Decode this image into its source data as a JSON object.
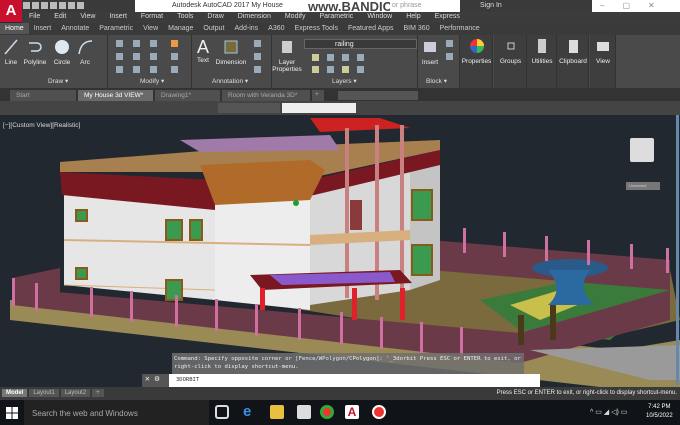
{
  "titlebar": {
    "app_logo": "A",
    "title": "Autodesk AutoCAD 2017   My House",
    "watermark": "www.BANDICAM.com",
    "search_placeholder": "or phrase",
    "sign_in": "Sign In"
  },
  "menu": [
    "File",
    "Edit",
    "View",
    "Insert",
    "Format",
    "Tools",
    "Draw",
    "Dimension",
    "Modify",
    "Parametric",
    "Window",
    "Help",
    "Express"
  ],
  "ribbon_tabs": [
    "Home",
    "Insert",
    "Annotate",
    "Parametric",
    "View",
    "Manage",
    "Output",
    "Add-ins",
    "A360",
    "Express Tools",
    "Featured Apps",
    "BIM 360",
    "Performance"
  ],
  "ribbon": {
    "draw": {
      "label": "Draw ▾",
      "tools": [
        "Line",
        "Polyline",
        "Circle",
        "Arc"
      ]
    },
    "modify": {
      "label": "Modify ▾"
    },
    "annotation": {
      "label": "Annotation ▾",
      "tools": [
        "Text",
        "Dimension"
      ]
    },
    "layers": {
      "label": "Layers ▾",
      "layer_properties": "Layer Properties",
      "current_layer": "railing"
    },
    "block": {
      "label": "Block ▾",
      "insert": "Insert"
    },
    "properties": "Properties",
    "groups": "Groups",
    "utilities": "Utilities",
    "clipboard": "Clipboard",
    "view": "View"
  },
  "doc_tabs": [
    "Start",
    "My House 3d VIEW*",
    "Drawing1*",
    "Room with Veranda 3D*"
  ],
  "viewport": {
    "label": "[−][Custom View][Realistic]",
    "viewcube_label": "Unnamed"
  },
  "command": {
    "history": "Command: Specify opposite corner or [Fence/WPolygon/CPolygon]: '_3dorbit Press ESC or ENTER to exit, or right-click to display shortcut-menu.",
    "input": "3DORBIT"
  },
  "layout_tabs": [
    "Model",
    "Layout1",
    "Layout2"
  ],
  "status_message": "Press ESC or ENTER to exit, or right-click to display shortcut-menu.",
  "taskbar": {
    "search": "Search the web and Windows",
    "time": "7:42 PM",
    "date": "10/5/2022"
  },
  "colors": {
    "autocad_red": "#c8102e",
    "viewport_bg": "#212830"
  }
}
